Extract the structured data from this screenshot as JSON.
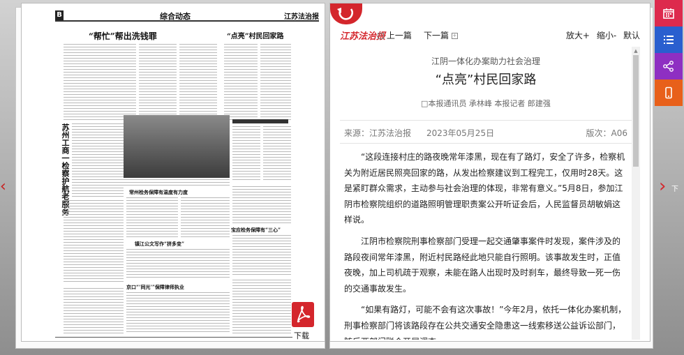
{
  "newspaper": {
    "edition_badge": "B",
    "section_title": "综合动态",
    "brand": "江苏法治报",
    "headline_main": "“帮忙”帮出洗钱罪",
    "headline_right": "“点亮”村民回家路",
    "headline_sub1": "常州检务保障有温度有力度",
    "headline_sub2": "宝应检务保障有“三心”",
    "headline_sub3": "镇江公文写作“拼多变”",
    "headline_sub4": "京口“‘同光’”保障律师执业",
    "vertical_title": "苏州工商一检察护航老服务"
  },
  "nav": {
    "prev_arrow": "‹",
    "next_arrow": "›",
    "next_label": "下",
    "download_label": "下载"
  },
  "toolbar": {
    "brand": "江苏法治报",
    "prev_label": "上一篇",
    "next_label": "下一篇",
    "zoom_in": "放大+",
    "zoom_out": "缩小-",
    "default": "默认"
  },
  "article": {
    "subtitle": "江阴一体化办案助力社会治理",
    "title": "“点亮”村民回家路",
    "byline": "□本报通讯员 承林峰 本报记者 郎建强",
    "source": "来源：江苏法治报",
    "date": "2023年05月25日",
    "edition": "版次：A06",
    "paragraphs": [
      "“这段连接村庄的路夜晚常年漆黑，现在有了路灯，安全了许多，检察机关为附近居民照亮回家的路，从发出检察建议到工程完工，仅用时28天。这是紧盯群众需求，主动参与社会治理的体现，非常有意义。”5月8日，参加江阴市检察院组织的道路照明管理职责案公开听证会后，人民监督员胡敏娟这样说。",
      "江阴市检察院刑事检察部门受理一起交通肇事案件时发现，案件涉及的路段夜间常年漆黑，附近村民路经此地只能自行照明。该事故发生时，正值夜晚，加上司机疏于观察，未能在路人出现时及时刹车，最终导致一死一伤的交通事故发生。",
      "“如果有路灯，可能不会有这次事故！”今年2月，依托一体化办案机制，刑事检察部门将该路段存在公共交通安全隐患这一线索移送公益诉讼部门，随后两部门联合开展调查。"
    ]
  },
  "icons": {
    "calendar": "calendar-icon",
    "list": "list-icon",
    "share": "share-icon",
    "mobile": "mobile-icon",
    "pdf": "pdf-icon",
    "back": "back-arrow-icon"
  },
  "colors": {
    "accent_red": "#d4262c",
    "sidebar_pink": "#dd2a4d",
    "sidebar_blue": "#2a5fcf",
    "sidebar_purple": "#8e2fc2",
    "sidebar_orange": "#e8601a"
  }
}
